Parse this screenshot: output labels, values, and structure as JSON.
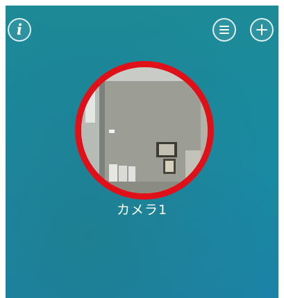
{
  "header": {
    "info_icon": "info-icon",
    "menu_icon": "menu-icon",
    "add_icon": "plus-icon",
    "info_glyph": "i"
  },
  "camera": {
    "name": "カメラ1"
  },
  "colors": {
    "background": "#1a8ba3",
    "thumbnail_ring": "#e01018",
    "text": "#ffffff"
  }
}
